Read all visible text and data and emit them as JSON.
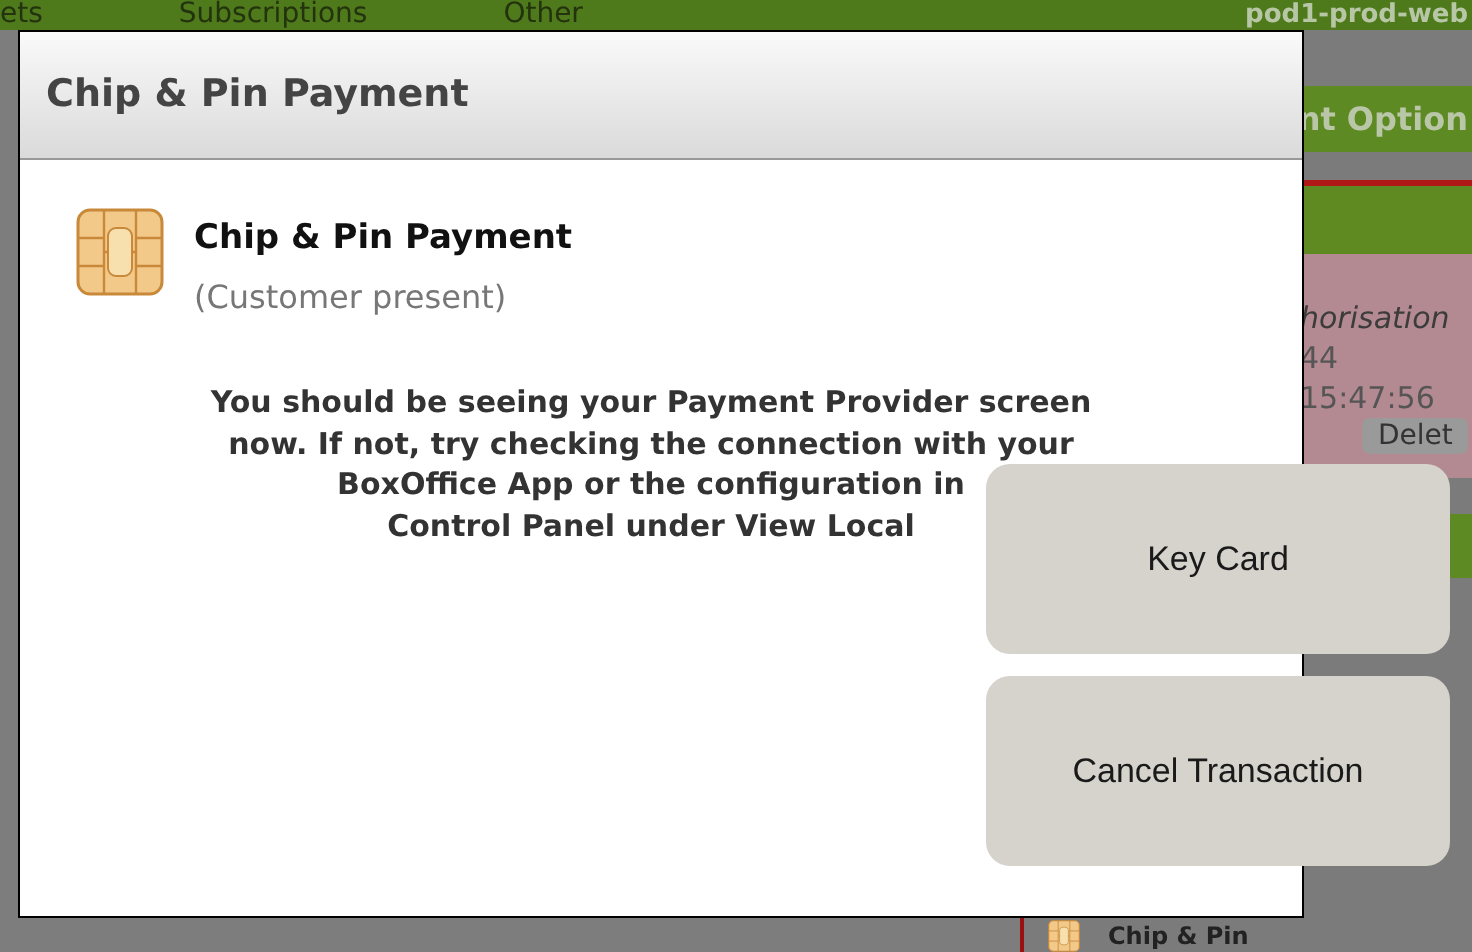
{
  "nav": {
    "items": [
      "ets",
      "Subscriptions",
      "Other"
    ],
    "server": "pod1-prod-web"
  },
  "side_panel": {
    "heading": "nt Option",
    "status": "horisation",
    "number": "44",
    "time": "15:47:56",
    "button": "Delet",
    "payment_label": "Chip & Pin"
  },
  "dialog": {
    "title": "Chip & Pin Payment",
    "method": "Chip & Pin Payment",
    "note": "(Customer present)",
    "message_lines": [
      "You should be seeing your Payment Provider screen",
      "now. If not, try checking the connection with your",
      "BoxOffice App or the configuration in",
      "Control Panel under View Local"
    ]
  },
  "actions": [
    "Key Card",
    "Cancel Transaction"
  ]
}
